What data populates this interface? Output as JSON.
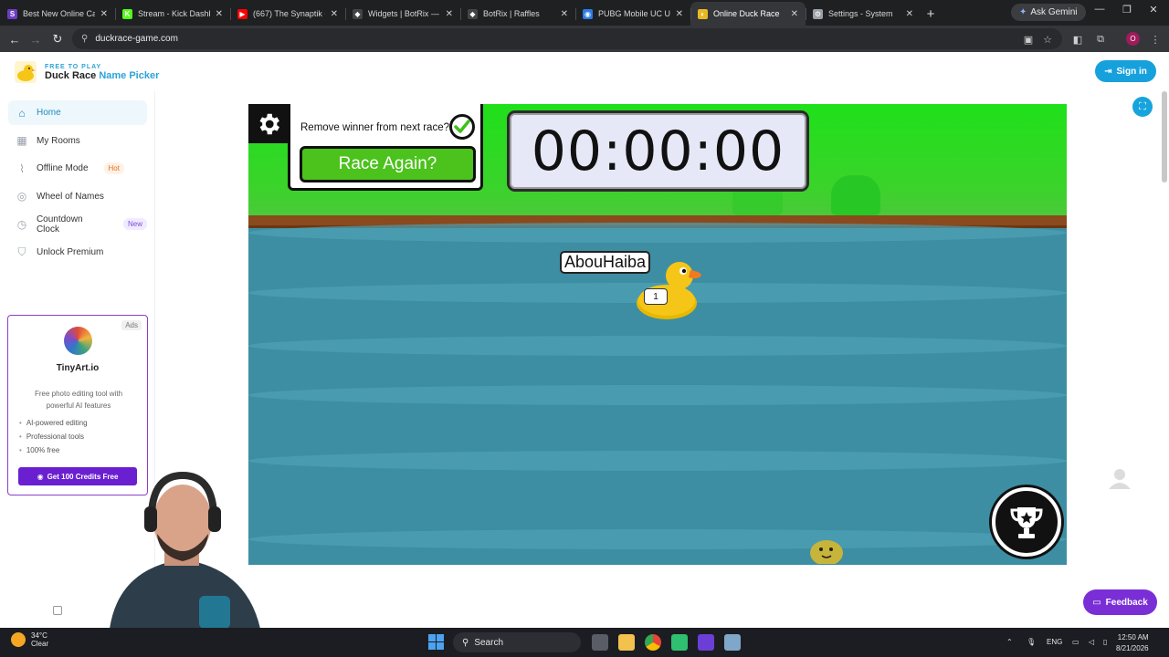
{
  "browser": {
    "tabs": [
      {
        "title": "Best New Online Casin",
        "color": "#6d3cc4",
        "glyph": "S"
      },
      {
        "title": "Stream - Kick Dashbo",
        "color": "#53fc18",
        "glyph": "K"
      },
      {
        "title": "(667) The Synaptik - Y",
        "color": "#ff0000",
        "glyph": "▶"
      },
      {
        "title": "Widgets | BotRix — Cl",
        "color": "#444444",
        "glyph": "◆"
      },
      {
        "title": "BotRix | Raffles",
        "color": "#444444",
        "glyph": "◆"
      },
      {
        "title": "PUBG Mobile UC Unit",
        "color": "#2b7de9",
        "glyph": "◉"
      },
      {
        "title": "Online Duck Race",
        "color": "#e8b923",
        "glyph": "◐"
      },
      {
        "title": "Settings - System",
        "color": "#9aa0a6",
        "glyph": "⚙"
      }
    ],
    "active_tab": 6,
    "gemini_label": "Ask Gemini",
    "url": "duckrace-game.com",
    "profile_initial": "O"
  },
  "site": {
    "logo_small": "FREE TO PLAY",
    "logo_name": "Duck Race",
    "logo_accent": "Name Picker",
    "signin_label": "Sign in"
  },
  "sidebar": {
    "items": [
      {
        "label": "Home",
        "icon": "home-icon",
        "badge": ""
      },
      {
        "label": "My Rooms",
        "icon": "grid-icon",
        "badge": ""
      },
      {
        "label": "Offline Mode",
        "icon": "wifi-off-icon",
        "badge": "Hot"
      },
      {
        "label": "Wheel of Names",
        "icon": "wheel-icon",
        "badge": ""
      },
      {
        "label": "Countdown Clock",
        "icon": "clock-icon",
        "badge": "New"
      },
      {
        "label": "Unlock Premium",
        "icon": "shield-icon",
        "badge": ""
      }
    ],
    "active": 0
  },
  "ad": {
    "label": "Ads",
    "name": "TinyArt.io",
    "description": "Free photo editing tool with powerful AI features",
    "features": [
      "AI-powered editing",
      "Professional tools",
      "100% free"
    ],
    "cta": "Get 100 Credits Free"
  },
  "game": {
    "remove_winner_label": "Remove winner from next race?",
    "remove_winner_checked": true,
    "race_again_label": "Race Again?",
    "timer": "00:00:00",
    "duck_name": "AbouHaiba",
    "duck_number": "1"
  },
  "feedback_label": "Feedback",
  "taskbar": {
    "temperature": "34°C",
    "weather": "Clear",
    "search_placeholder": "Search",
    "language": "ENG",
    "time": "12:50 AM",
    "date": "8/21/2026"
  },
  "colors": {
    "brand": "#16a1dc",
    "grass": "#1fe01a",
    "water": "#3d8ea3",
    "race_button": "#4cc21c",
    "feedback": "#7a2fd6"
  }
}
